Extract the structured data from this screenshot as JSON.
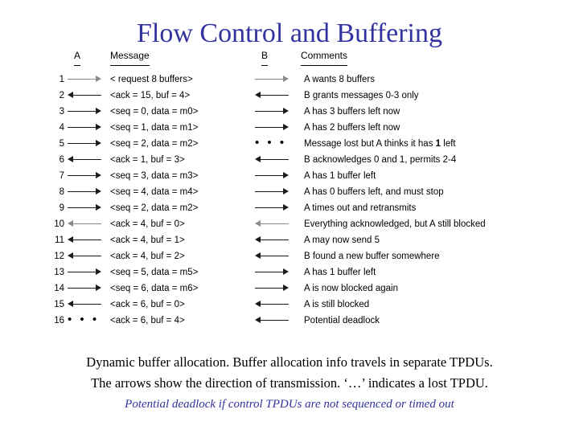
{
  "title": "Flow Control and Buffering",
  "colors": {
    "title": "#3333a0",
    "accent_footer": "#3333a0",
    "text": "#000000",
    "background": "#ffffff"
  },
  "headers": {
    "a": "A",
    "message": "Message",
    "b": "B",
    "comments": "Comments"
  },
  "rows": [
    {
      "num": "1",
      "arrow_a": "right-faint",
      "message": "< request 8 buffers>",
      "arrow_b": "right-faint",
      "comment": "A wants 8 buffers"
    },
    {
      "num": "2",
      "arrow_a": "left",
      "message": "<ack = 15, buf = 4>",
      "arrow_b": "left",
      "comment": "B grants messages 0-3 only"
    },
    {
      "num": "3",
      "arrow_a": "right",
      "message": "<seq = 0, data = m0>",
      "arrow_b": "right",
      "comment": "A has 3 buffers left now"
    },
    {
      "num": "4",
      "arrow_a": "right",
      "message": "<seq = 1, data = m1>",
      "arrow_b": "right",
      "comment": "A has 2 buffers left now"
    },
    {
      "num": "5",
      "arrow_a": "right",
      "message": "<seq = 2, data = m2>",
      "arrow_b": "dots",
      "comment": "Message lost but A thinks it has 1 left",
      "comment_bold": "1"
    },
    {
      "num": "6",
      "arrow_a": "left",
      "message": "<ack = 1, buf = 3>",
      "arrow_b": "left",
      "comment": "B acknowledges 0 and 1, permits 2-4"
    },
    {
      "num": "7",
      "arrow_a": "right",
      "message": "<seq = 3, data = m3>",
      "arrow_b": "right",
      "comment": "A has 1 buffer left"
    },
    {
      "num": "8",
      "arrow_a": "right",
      "message": "<seq = 4, data = m4>",
      "arrow_b": "right",
      "comment": "A has 0 buffers left, and must stop"
    },
    {
      "num": "9",
      "arrow_a": "right",
      "message": "<seq = 2, data = m2>",
      "arrow_b": "right",
      "comment": "A times out and retransmits"
    },
    {
      "num": "10",
      "arrow_a": "left-faint",
      "message": "<ack = 4, buf = 0>",
      "arrow_b": "left-faint",
      "comment": "Everything acknowledged, but A still blocked"
    },
    {
      "num": "11",
      "arrow_a": "left",
      "message": "<ack = 4, buf = 1>",
      "arrow_b": "left",
      "comment": "A may now send 5"
    },
    {
      "num": "12",
      "arrow_a": "left",
      "message": "<ack = 4, buf = 2>",
      "arrow_b": "left",
      "comment": "B found a new buffer somewhere"
    },
    {
      "num": "13",
      "arrow_a": "right",
      "message": "<seq = 5, data = m5>",
      "arrow_b": "right",
      "comment": "A has 1 buffer left"
    },
    {
      "num": "14",
      "arrow_a": "right",
      "message": "<seq = 6, data = m6>",
      "arrow_b": "right",
      "comment": "A is now blocked again"
    },
    {
      "num": "15",
      "arrow_a": "left",
      "message": "<ack = 6, buf = 0>",
      "arrow_b": "left",
      "comment": "A is still blocked"
    },
    {
      "num": "16",
      "arrow_a": "dots",
      "message": "<ack = 6, buf = 4>",
      "arrow_b": "left",
      "comment": "Potential deadlock"
    }
  ],
  "dots_glyph": "• • •",
  "footer": {
    "line1": "Dynamic buffer allocation. Buffer allocation info travels in separate TPDUs.",
    "line2": "The arrows show the direction of transmission. ‘…’ indicates a lost TPDU.",
    "line3": "Potential deadlock if control TPDUs are not sequenced or timed out"
  }
}
